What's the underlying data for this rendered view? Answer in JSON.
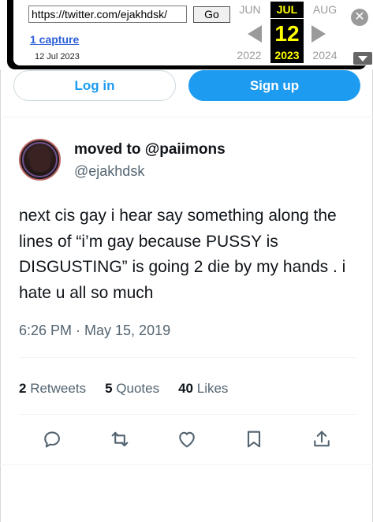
{
  "wayback": {
    "url": "https://twitter.com/ejakhdsk/",
    "go_label": "Go",
    "captures_label": "1 capture",
    "capture_date": "12 Jul 2023",
    "months": {
      "prev": "JUN",
      "current": "JUL",
      "next": "AUG"
    },
    "day": "12",
    "years": {
      "prev": "2022",
      "current": "2023",
      "next": "2024"
    },
    "close_icon": "close-icon",
    "expand_icon": "expand-icon"
  },
  "auth": {
    "login_label": "Log in",
    "signup_label": "Sign up"
  },
  "tweet": {
    "display_name": "moved to @paiimons",
    "handle": "@ejakhdsk",
    "text": "next cis gay i hear say something along the lines of “i’m gay because PUSSY is DISGUSTING” is going 2 die by my hands . i hate u all so much",
    "timestamp": "6:26 PM · May 15, 2019",
    "stats": {
      "retweets_count": "2",
      "retweets_label": "Retweets",
      "quotes_count": "5",
      "quotes_label": "Quotes",
      "likes_count": "40",
      "likes_label": "Likes"
    },
    "actions": [
      "reply-icon",
      "retweet-icon",
      "like-icon",
      "bookmark-icon",
      "share-icon"
    ]
  },
  "colors": {
    "accent": "#1d9bf0",
    "text_primary": "#0f1419",
    "text_secondary": "#536471",
    "wayback_highlight": "#ffff00"
  }
}
